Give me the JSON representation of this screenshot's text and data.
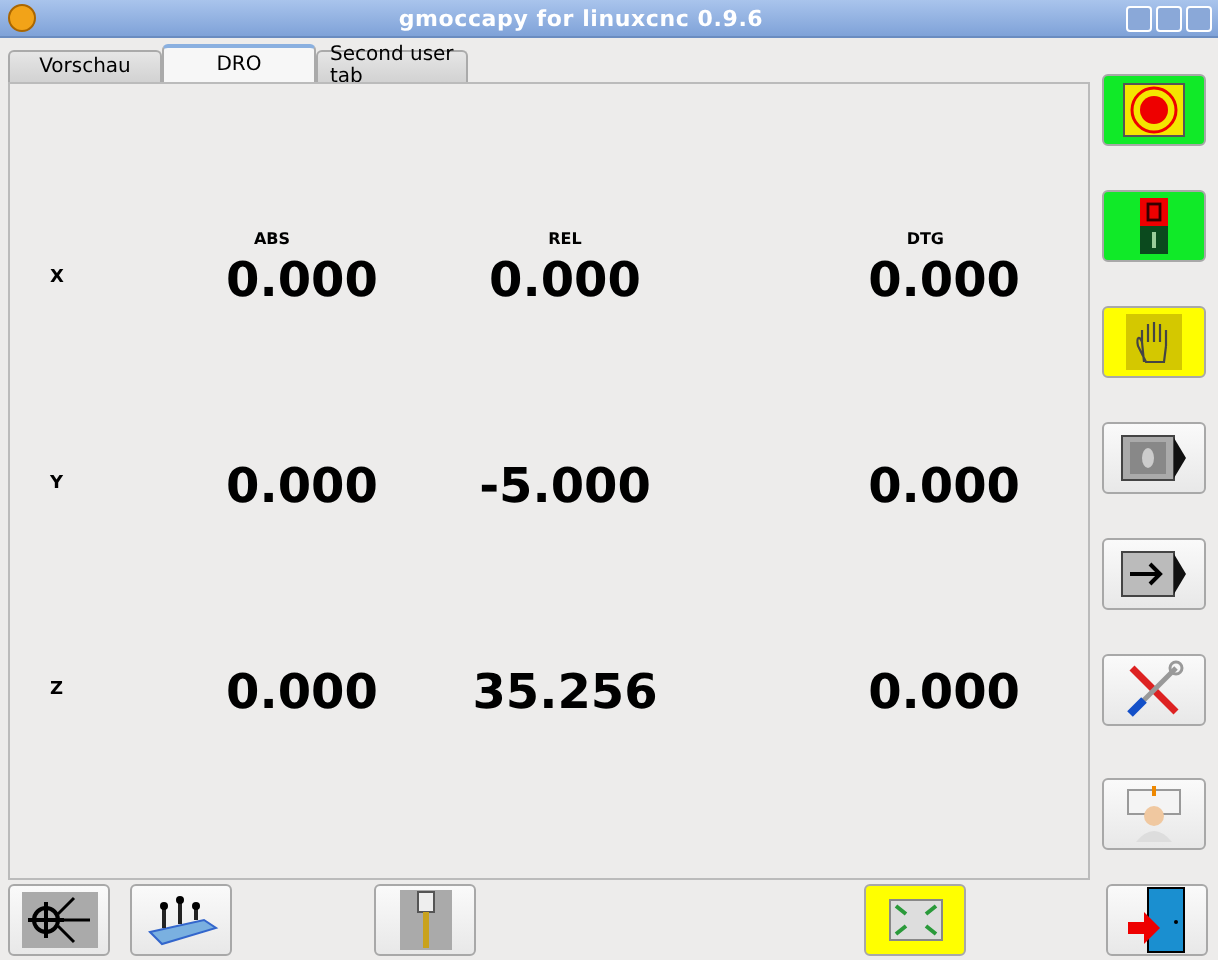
{
  "window": {
    "title": "gmoccapy for linuxcnc 0.9.6"
  },
  "tabs": [
    {
      "label": "Vorschau",
      "selected": false
    },
    {
      "label": "DRO",
      "selected": true
    },
    {
      "label": "Second user tab",
      "selected": false
    }
  ],
  "dro": {
    "columns": [
      "ABS",
      "REL",
      "DTG"
    ],
    "rows": [
      {
        "axis": "X",
        "values": [
          "0.000",
          "0.000",
          "0.000"
        ]
      },
      {
        "axis": "Y",
        "values": [
          "0.000",
          "-5.000",
          "0.000"
        ]
      },
      {
        "axis": "Z",
        "values": [
          "0.000",
          "35.256",
          "0.000"
        ]
      }
    ]
  },
  "side_buttons": [
    {
      "kind": "estop",
      "on": true
    },
    {
      "kind": "power",
      "on": true
    },
    {
      "kind": "manual",
      "on": true
    },
    {
      "kind": "mdi",
      "on": false
    },
    {
      "kind": "auto",
      "on": false
    },
    {
      "kind": "settings",
      "on": false
    },
    {
      "kind": "user",
      "on": false
    }
  ],
  "bottom_buttons": [
    {
      "kind": "homing",
      "on": false
    },
    {
      "kind": "touchoff",
      "on": false
    },
    {
      "kind": "tool",
      "on": false
    },
    {
      "kind": "fullscreen",
      "on": true
    },
    {
      "kind": "exit",
      "on": false
    }
  ]
}
